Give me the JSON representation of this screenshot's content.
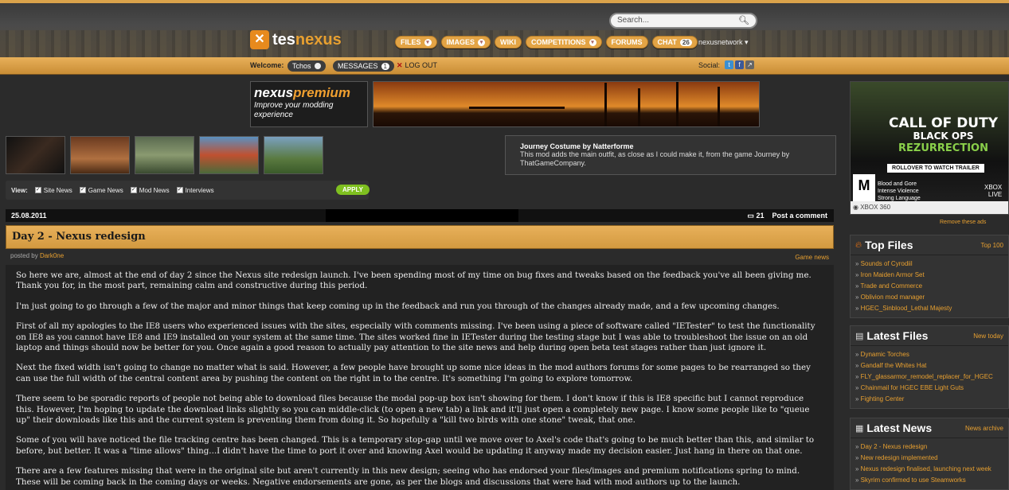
{
  "header": {
    "logo_left": "tes",
    "logo_right": "nexus",
    "search_placeholder": "Search...",
    "nav": [
      {
        "label": "FILES",
        "badge": ""
      },
      {
        "label": "IMAGES",
        "badge": ""
      },
      {
        "label": "WIKI",
        "badge": ""
      },
      {
        "label": "COMPETITIONS",
        "badge": ""
      },
      {
        "label": "FORUMS",
        "badge": ""
      },
      {
        "label": "CHAT",
        "badge": "26"
      }
    ],
    "network_label": "nexusnetwork"
  },
  "userbar": {
    "welcome_label": "Welcome:",
    "username": "Tchos",
    "messages_label": "MESSAGES",
    "messages_count": "1",
    "logout_label": "LOG OUT",
    "social_label": "Social:"
  },
  "premium": {
    "brand_1": "nexus",
    "brand_2": "premium",
    "tagline": "Improve your modding experience"
  },
  "view_filter": {
    "label": "View:",
    "options": [
      "Site News",
      "Game News",
      "Mod News",
      "Interviews"
    ],
    "apply_label": "APPLY"
  },
  "featured_mod": {
    "title": "Journey Costume by Natterforme",
    "description": "This mod adds the main outfit, as close as I could make it, from the game Journey by ThatGameCompany."
  },
  "article": {
    "date": "25.08.2011",
    "comment_count": "21",
    "post_comment_label": "Post a comment",
    "title": "Day 2 - Nexus redesign",
    "posted_by_label": "posted by",
    "author": "Dark0ne",
    "category": "Game news",
    "paragraphs": [
      "So here we are, almost at the end of day 2 since the Nexus site redesign launch. I've been spending most of my time on bug fixes and tweaks based on the feedback you've all been giving me. Thank you for, in the most part, remaining calm and constructive during this period.",
      "I'm just going to go through a few of the major and minor things that keep coming up in the feedback and run you through of the changes already made, and a few upcoming changes.",
      "First of all my apologies to the IE8 users who experienced issues with the sites, especially with comments missing. I've been using a piece of software called \"IETester\" to test the functionality on IE8 as you cannot have IE8 and IE9 installed on your system at the same time. The sites worked fine in IETester during the testing stage but I was able to troubleshoot the issue on an old laptop and things should now be better for you. Once again a good reason to actually pay attention to the site news and help during open beta test stages rather than just ignore it.",
      "Next the fixed width isn't going to change no matter what is said. However, a few people have brought up some nice ideas in the mod authors forums for some pages to be rearranged so they can use the full width of the central content area by pushing the content on the right in to the centre. It's something I'm going to explore tomorrow.",
      "There seem to be sporadic reports of people not being able to download files because the modal pop-up box isn't showing for them. I don't know if this is IE8 specific but I cannot reproduce this. However, I'm hoping to update the download links slightly so you can middle-click (to open a new tab) a link and it'll just open a completely new page. I know some people like to \"queue up\" their downloads like this and the current system is preventing them from doing it. So hopefully a \"kill two birds with one stone\" tweak, that one.",
      "Some of you will have noticed the file tracking centre has been changed. This is a temporary stop-gap until we move over to Axel's code that's going to be much better than this, and similar to before, but better. It was a \"time allows\" thing...I didn't have the time to port it over and knowing Axel would be updating it anyway made my decision easier. Just hang in there on that one.",
      "There are a few features missing that were in the original site but aren't currently in this new design; seeing who has endorsed your files/images and premium notifications spring to mind. These will be coming back in the coming days or weeks. Negative endorsements are gone, as per the blogs and discussions that were had with mod authors up to the launch."
    ]
  },
  "ad": {
    "line1": "CALL OF DUTY",
    "line2": "BLACK OPS",
    "line3": "REZURRECTION",
    "cta": "ROLLOVER TO WATCH TRAILER",
    "rating": "M",
    "descriptors": [
      "Blood and Gore",
      "Intense Violence",
      "Strong Language"
    ],
    "platform_1": "XBOX",
    "platform_2": "LIVE",
    "console": "XBOX 360",
    "remove_label": "Remove these ads"
  },
  "sidebar": {
    "top_files": {
      "title": "Top Files",
      "link": "Top 100",
      "items": [
        "Sounds of Cyrodiil",
        "Iron Maiden Armor Set",
        "Trade and Commerce",
        "Oblivion mod manager",
        "HGEC_Sinblood_Lethal Majesty"
      ]
    },
    "latest_files": {
      "title": "Latest Files",
      "link": "New today",
      "items": [
        "Dynamic Torches",
        "Gandalf the Whites Hat",
        "FLY_glassarmor_remodel_replacer_for_HGEC",
        "Chainmail for HGEC EBE Light Guts",
        "Fighting Center"
      ]
    },
    "latest_news": {
      "title": "Latest News",
      "link": "News archive",
      "items": [
        "Day 2 - Nexus redesign",
        "New redesign implemented",
        "Nexus redesign finalised, launching next week",
        "Skyrim confirmed to use Steamworks"
      ]
    }
  },
  "colors": {
    "accent": "#e8a030",
    "background": "#2b2b2b",
    "title_bar": "#e8b05a"
  }
}
